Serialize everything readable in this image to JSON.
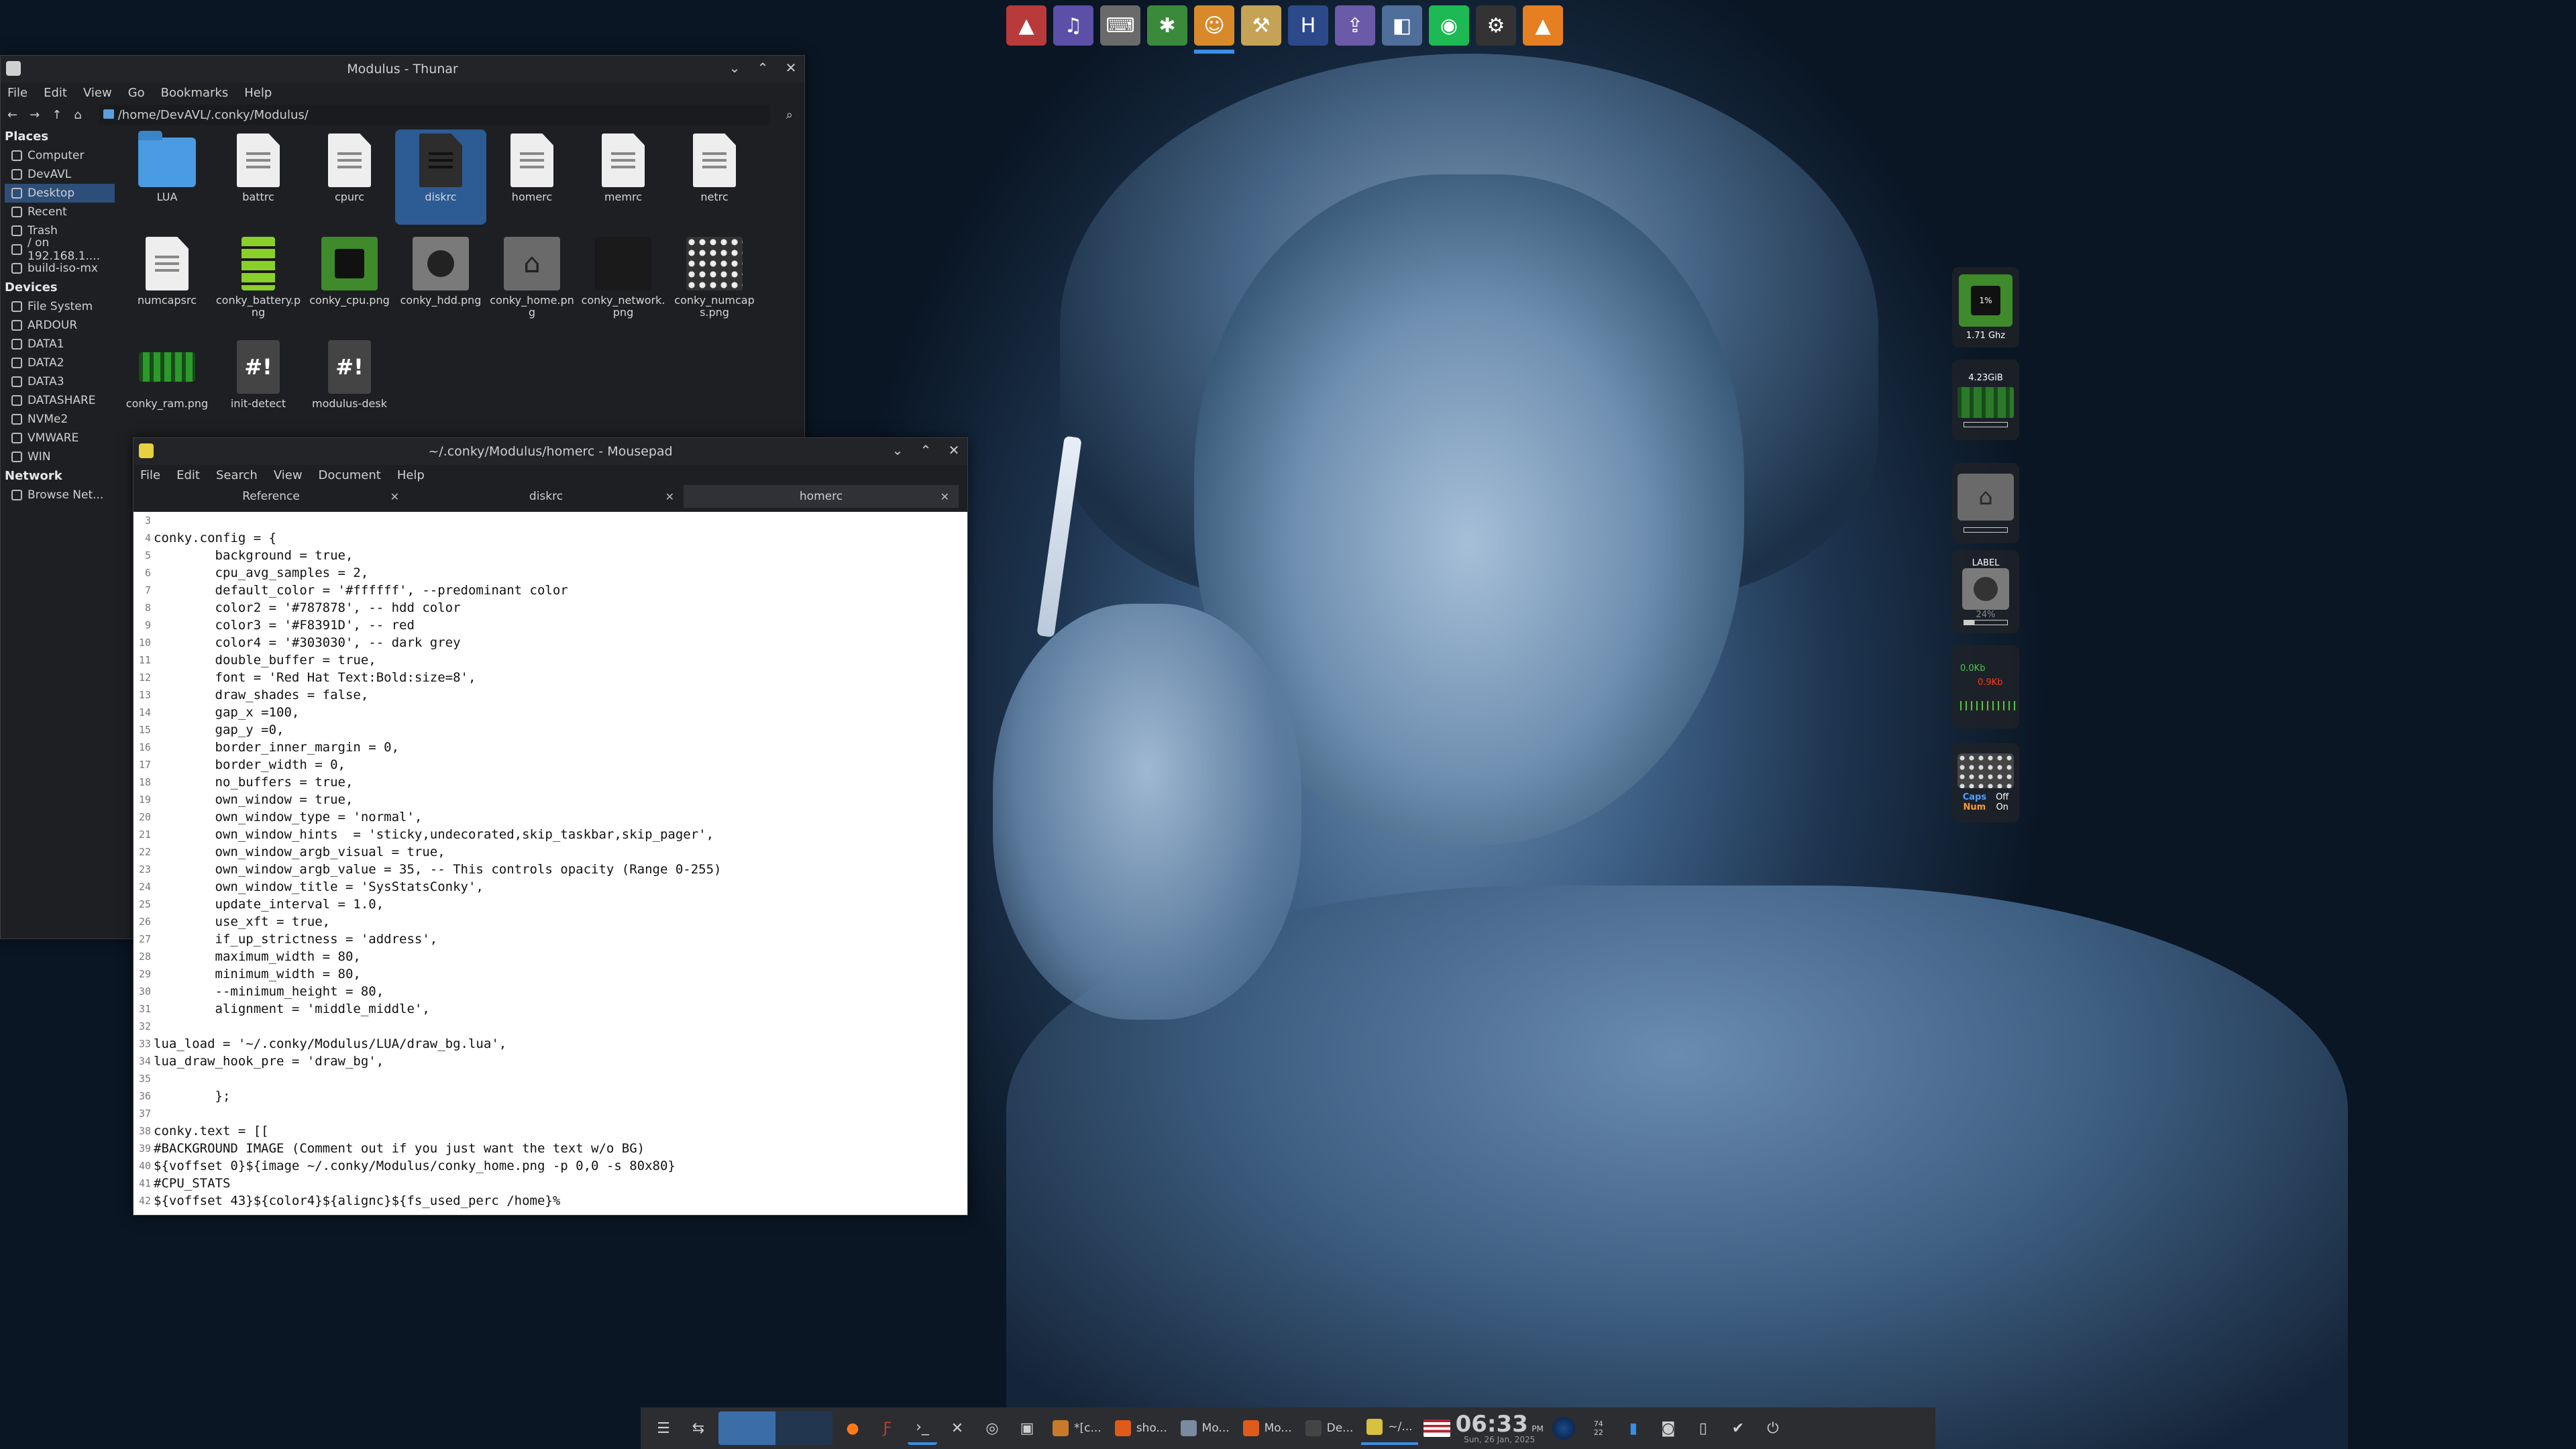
{
  "launcher": {
    "apps": [
      {
        "name": "app-a",
        "color": "#b83a3a",
        "glyph": "▲"
      },
      {
        "name": "headphones",
        "color": "#5b4fa8",
        "glyph": "♫"
      },
      {
        "name": "keyboard",
        "color": "#6a6a6a",
        "glyph": "⌨"
      },
      {
        "name": "game",
        "color": "#3b8a3b",
        "glyph": "✱"
      },
      {
        "name": "chat",
        "color": "#d88a2a",
        "glyph": "☺"
      },
      {
        "name": "hammer",
        "color": "#c4a356",
        "glyph": "⚒"
      },
      {
        "name": "hexchat",
        "color": "#2c4a8a",
        "glyph": "H"
      },
      {
        "name": "updater",
        "color": "#6a5aa8",
        "glyph": "⇪"
      },
      {
        "name": "mixer",
        "color": "#4f6f9a",
        "glyph": "◧"
      },
      {
        "name": "spotify",
        "color": "#1db954",
        "glyph": "◉"
      },
      {
        "name": "settings",
        "color": "#333333",
        "glyph": "⚙"
      },
      {
        "name": "vlc",
        "color": "#e67e22",
        "glyph": "▲"
      }
    ]
  },
  "thunar": {
    "title": "Modulus - Thunar",
    "menu": [
      "File",
      "Edit",
      "View",
      "Go",
      "Bookmarks",
      "Help"
    ],
    "path": "/home/DevAVL/.conky/Modulus/",
    "places_header": "Places",
    "places": [
      "Computer",
      "DevAVL",
      "Desktop",
      "Recent",
      "Trash",
      "/ on 192.168.1....",
      "build-iso-mx"
    ],
    "devices_header": "Devices",
    "devices": [
      "File System",
      "ARDOUR",
      "DATA1",
      "DATA2",
      "DATA3",
      "DATASHARE",
      "NVMe2",
      "VMWARE",
      "WIN"
    ],
    "network_header": "Network",
    "network": [
      "Browse Net..."
    ],
    "files": [
      {
        "label": "LUA",
        "kind": "folder"
      },
      {
        "label": "battrc",
        "kind": "doc"
      },
      {
        "label": "cpurc",
        "kind": "doc"
      },
      {
        "label": "diskrc",
        "kind": "doc-dark",
        "selected": true
      },
      {
        "label": "homerc",
        "kind": "doc"
      },
      {
        "label": "memrc",
        "kind": "doc"
      },
      {
        "label": "netrc",
        "kind": "doc"
      },
      {
        "label": "numcapsrc",
        "kind": "doc"
      },
      {
        "label": "conky_battery.png",
        "kind": "battery"
      },
      {
        "label": "conky_cpu.png",
        "kind": "cpu"
      },
      {
        "label": "conky_hdd.png",
        "kind": "hdd"
      },
      {
        "label": "conky_home.png",
        "kind": "home"
      },
      {
        "label": "conky_network.png",
        "kind": "network"
      },
      {
        "label": "conky_numcaps.png",
        "kind": "numcaps"
      },
      {
        "label": "conky_ram.png",
        "kind": "ram"
      },
      {
        "label": "init-detect",
        "kind": "script"
      },
      {
        "label": "modulus-desk",
        "kind": "script"
      }
    ]
  },
  "mousepad": {
    "title": "~/.conky/Modulus/homerc - Mousepad",
    "menu": [
      "File",
      "Edit",
      "Search",
      "View",
      "Document",
      "Help"
    ],
    "tabs": [
      {
        "label": "Reference",
        "active": false
      },
      {
        "label": "diskrc",
        "active": false
      },
      {
        "label": "homerc",
        "active": true
      }
    ],
    "lines": [
      {
        "n": "3",
        "t": ""
      },
      {
        "n": "4",
        "t": "conky.config = {"
      },
      {
        "n": "5",
        "t": "        background = true,"
      },
      {
        "n": "6",
        "t": "        cpu_avg_samples = 2,"
      },
      {
        "n": "7",
        "t": "        default_color = '#ffffff', --predominant color"
      },
      {
        "n": "8",
        "t": "        color2 = '#787878', -- hdd color"
      },
      {
        "n": "9",
        "t": "        color3 = '#F8391D', -- red"
      },
      {
        "n": "10",
        "t": "        color4 = '#303030', -- dark grey"
      },
      {
        "n": "11",
        "t": "        double_buffer = true,"
      },
      {
        "n": "12",
        "t": "        font = 'Red Hat Text:Bold:size=8',"
      },
      {
        "n": "13",
        "t": "        draw_shades = false,"
      },
      {
        "n": "14",
        "t": "        gap_x =100,"
      },
      {
        "n": "15",
        "t": "        gap_y =0,"
      },
      {
        "n": "16",
        "t": "        border_inner_margin = 0,"
      },
      {
        "n": "17",
        "t": "        border_width = 0,"
      },
      {
        "n": "18",
        "t": "        no_buffers = true,"
      },
      {
        "n": "19",
        "t": "        own_window = true,"
      },
      {
        "n": "20",
        "t": "        own_window_type = 'normal',"
      },
      {
        "n": "21",
        "t": "        own_window_hints  = 'sticky,undecorated,skip_taskbar,skip_pager',"
      },
      {
        "n": "22",
        "t": "        own_window_argb_visual = true,"
      },
      {
        "n": "23",
        "t": "        own_window_argb_value = 35, -- This controls opacity (Range 0-255)"
      },
      {
        "n": "24",
        "t": "        own_window_title = 'SysStatsConky',"
      },
      {
        "n": "25",
        "t": "        update_interval = 1.0,"
      },
      {
        "n": "26",
        "t": "        use_xft = true,"
      },
      {
        "n": "27",
        "t": "        if_up_strictness = 'address',"
      },
      {
        "n": "28",
        "t": "        maximum_width = 80,"
      },
      {
        "n": "29",
        "t": "        minimum_width = 80,"
      },
      {
        "n": "30",
        "t": "        --minimum_height = 80,"
      },
      {
        "n": "31",
        "t": "        alignment = 'middle_middle',"
      },
      {
        "n": "32",
        "t": ""
      },
      {
        "n": "33",
        "t": "lua_load = '~/.conky/Modulus/LUA/draw_bg.lua',"
      },
      {
        "n": "34",
        "t": "lua_draw_hook_pre = 'draw_bg',"
      },
      {
        "n": "35",
        "t": ""
      },
      {
        "n": "36",
        "t": "        };"
      },
      {
        "n": "37",
        "t": ""
      },
      {
        "n": "38",
        "t": "conky.text = [["
      },
      {
        "n": "39",
        "t": "#BACKGROUND IMAGE (Comment out if you just want the text w/o BG)"
      },
      {
        "n": "40",
        "t": "${voffset 0}${image ~/.conky/Modulus/conky_home.png -p 0,0 -s 80x80}"
      },
      {
        "n": "41",
        "t": "#CPU_STATS"
      },
      {
        "n": "42",
        "t": "${voffset 43}${color4}${alignc}${fs_used_perc /home}%"
      }
    ]
  },
  "conky": {
    "cpu_pct": "1%",
    "cpu_freq": "1.71 Ghz",
    "ram": "4.23GiB",
    "hdd_label": "LABEL",
    "hdd_pct": "24%",
    "net_up": "0.0Kb",
    "net_down": "0.9Kb",
    "caps": "Caps",
    "num": "Num",
    "caps_state": "Off",
    "num_state": "On"
  },
  "taskbar": {
    "tasks": [
      {
        "label": "*[c...",
        "color": "#c77b2a"
      },
      {
        "label": "sho...",
        "color": "#e05a1a"
      },
      {
        "label": "Mo...",
        "color": "#7a8aa0"
      },
      {
        "label": "Mo...",
        "color": "#e05a1a"
      },
      {
        "label": "De...",
        "color": "#444444"
      },
      {
        "label": "~/...",
        "color": "#d8c040"
      }
    ],
    "time": "06:33",
    "ampm": "PM",
    "date": "Sun, 26 Jan, 2025",
    "tray_num": "74\n22"
  }
}
